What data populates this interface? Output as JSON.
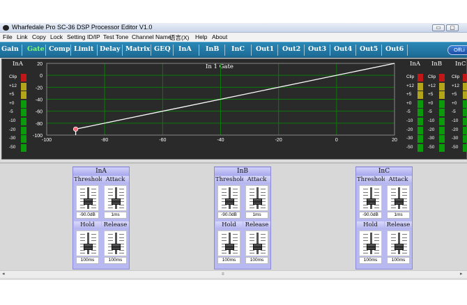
{
  "window": {
    "title": "Wharfedale Pro SC-36 DSP Processor Editor V1.0",
    "controls": [
      "▭",
      "▢"
    ]
  },
  "menu": [
    "File",
    "Link",
    "Copy",
    "Lock",
    "Setting ID/IP",
    "Test Tone",
    "Channel Name",
    "语言(X)",
    "Help",
    "About"
  ],
  "tabs": [
    "Gain",
    "Gate",
    "Comp",
    "Limit",
    "Delay",
    "Matrix",
    "GEQ",
    "InA",
    "InB",
    "InC",
    "Out1",
    "Out2",
    "Out3",
    "Out4",
    "Out5",
    "Out6"
  ],
  "active_tab": "Gate",
  "status": {
    "offline_label": "OffLi"
  },
  "graph": {
    "title": "In 1  Gate",
    "left_meter_label": "InA",
    "right_meter_labels": [
      "InA",
      "InB",
      "InC"
    ],
    "meter_scale": [
      "Clip",
      "+12",
      "+5",
      "+0",
      "-5",
      "-10",
      "-20",
      "-30",
      "-50"
    ],
    "y_ticks": [
      "20",
      "0",
      "-20",
      "-40",
      "-60",
      "-80",
      "-100"
    ],
    "x_ticks": [
      "-100",
      "-80",
      "-60",
      "-40",
      "-20",
      "0",
      "20"
    ],
    "threshold_db": -90,
    "colors": {
      "grid": "#0b7a0b",
      "line": "#ffffff",
      "meter_green": "#0a9a0a",
      "meter_yellow": "#b3a51a",
      "meter_red": "#c01818",
      "marker": "#ff6b7a"
    }
  },
  "channels": [
    {
      "name": "InA",
      "threshold_label": "Threshold",
      "threshold_value": "-90.0dB",
      "attack_label": "Attack",
      "attack_value": "1ms",
      "hold_label": "Hold",
      "hold_value": "100ms",
      "release_label": "Release",
      "release_value": "100ms"
    },
    {
      "name": "InB",
      "threshold_label": "Threshold",
      "threshold_value": "-90.0dB",
      "attack_label": "Attack",
      "attack_value": "1ms",
      "hold_label": "Hold",
      "hold_value": "100ms",
      "release_label": "Release",
      "release_value": "100ms"
    },
    {
      "name": "InC",
      "threshold_label": "Threshold",
      "threshold_value": "-90.0dB",
      "attack_label": "Attack",
      "attack_value": "1ms",
      "hold_label": "Hold",
      "hold_value": "100ms",
      "release_label": "Release",
      "release_value": "100ms"
    }
  ],
  "scrollbar": {
    "left_arrow": "◂",
    "right_arrow": "▸",
    "grip": "≡"
  }
}
